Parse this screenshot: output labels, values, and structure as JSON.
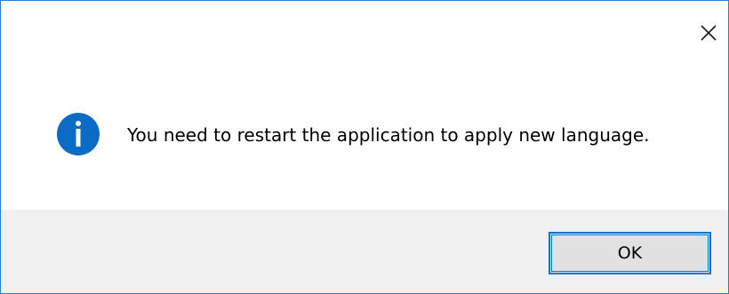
{
  "dialog": {
    "message": "You need to restart the application to apply new language.",
    "ok_label": "OK"
  },
  "icons": {
    "info": "info-icon",
    "close": "close-icon"
  },
  "colors": {
    "info_blue": "#0a6cc4",
    "button_border": "#0078d7",
    "footer_bg": "#f0f0f0",
    "window_border": "#2b7cd3"
  }
}
